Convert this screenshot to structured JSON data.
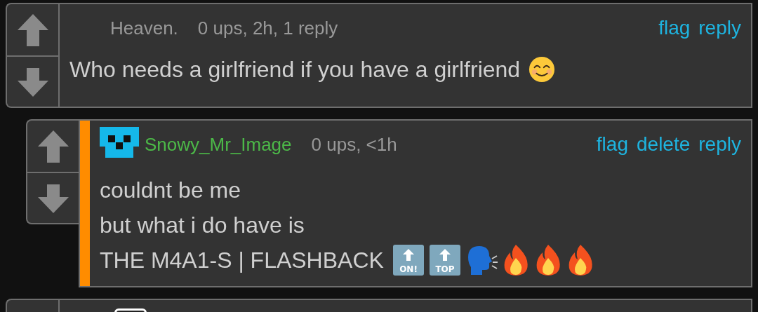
{
  "comments": [
    {
      "author": "Heaven.",
      "own": false,
      "has_avatar": false,
      "highlighted": false,
      "meta": "0 ups, 2h, 1 reply",
      "actions": [
        "flag",
        "reply"
      ],
      "lines": [
        {
          "text": "Who needs a girlfriend if you have a girlfriend",
          "emoji": [
            {
              "kind": "smiling-face"
            }
          ]
        }
      ]
    },
    {
      "author": "Snowy_Mr_Image",
      "own": true,
      "has_avatar": true,
      "highlighted": true,
      "meta": "0 ups, <1h",
      "actions": [
        "flag",
        "delete",
        "reply"
      ],
      "lines": [
        {
          "text": "couldnt be me"
        },
        {
          "text": "but what i do have is"
        },
        {
          "text": "THE M4A1-S | FLASHBACK",
          "emoji": [
            {
              "kind": "key",
              "label": "ON!"
            },
            {
              "kind": "key",
              "label": "TOP"
            },
            {
              "kind": "speaking-head"
            },
            {
              "kind": "fire"
            },
            {
              "kind": "fire"
            },
            {
              "kind": "fire"
            }
          ]
        }
      ]
    }
  ],
  "more_below": true
}
